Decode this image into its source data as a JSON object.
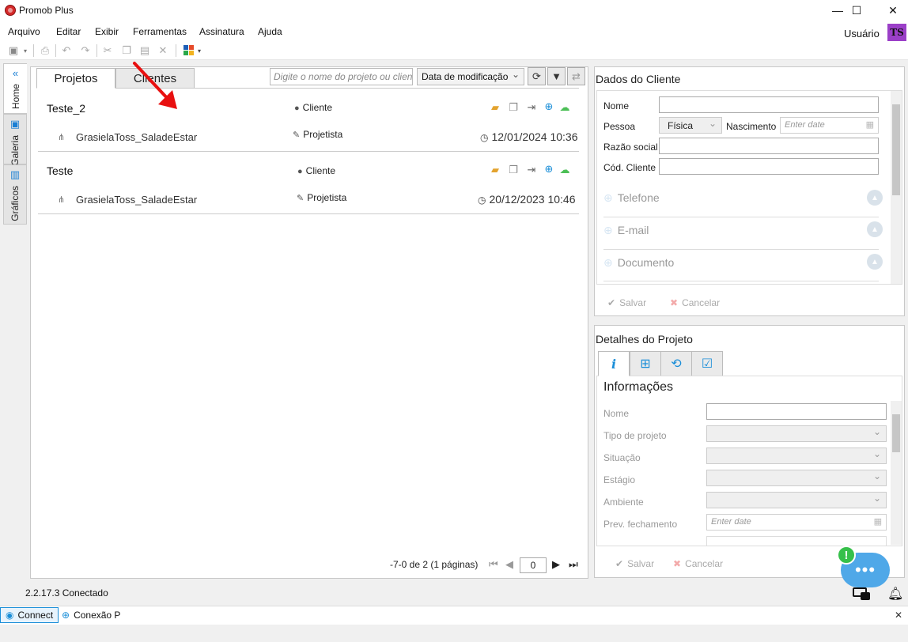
{
  "window": {
    "title": "Promob Plus",
    "minimize": "—",
    "maximize": "☐",
    "close": "✕"
  },
  "menu": [
    "Arquivo",
    "Editar",
    "Exibir",
    "Ferramentas",
    "Assinatura",
    "Ajuda"
  ],
  "user": {
    "label": "Usuário",
    "initials": "TS"
  },
  "side_tabs": [
    "Home",
    "Galeria",
    "Gráficos"
  ],
  "projects_panel": {
    "tabs": [
      "Projetos",
      "Clientes"
    ],
    "search_placeholder": "Digite o nome do projeto ou cliente",
    "sort_value": "Data de modificação",
    "projects": [
      {
        "name": "Teste_2",
        "client_label": "Cliente",
        "item_name": "GrasielaToss_SaladeEstar",
        "designer_label": "Projetista",
        "date": "12/01/2024 10:36"
      },
      {
        "name": "Teste",
        "client_label": "Cliente",
        "item_name": "GrasielaToss_SaladeEstar",
        "designer_label": "Projetista",
        "date": "20/12/2023 10:46"
      }
    ],
    "pager_text": "-7-0 de 2 (1 páginas)",
    "pager_value": "0"
  },
  "client_panel": {
    "title": "Dados do Cliente",
    "nome_label": "Nome",
    "pessoa_label": "Pessoa",
    "pessoa_value": "Física",
    "nascimento_label": "Nascimento",
    "date_placeholder": "Enter date",
    "razao_label": "Razão social",
    "cod_label": "Cód. Cliente",
    "sections": [
      "Telefone",
      "E-mail",
      "Documento"
    ],
    "save_label": "Salvar",
    "cancel_label": "Cancelar"
  },
  "project_details": {
    "title": "Detalhes do Projeto",
    "heading": "Informações",
    "labels": [
      "Nome",
      "Tipo de projeto",
      "Situação",
      "Estágio",
      "Ambiente",
      "Prev. fechamento"
    ],
    "date_placeholder": "Enter date",
    "save_label": "Salvar",
    "cancel_label": "Cancelar"
  },
  "status": {
    "version": "2.2.17.3",
    "state": "Conectado"
  },
  "bottom_tabs": [
    "Connect",
    "Conexão P"
  ],
  "colors": {
    "accent": "#1a8ed8",
    "avatar": "#9b3fc8",
    "annotation_arrow": "#e81010"
  }
}
